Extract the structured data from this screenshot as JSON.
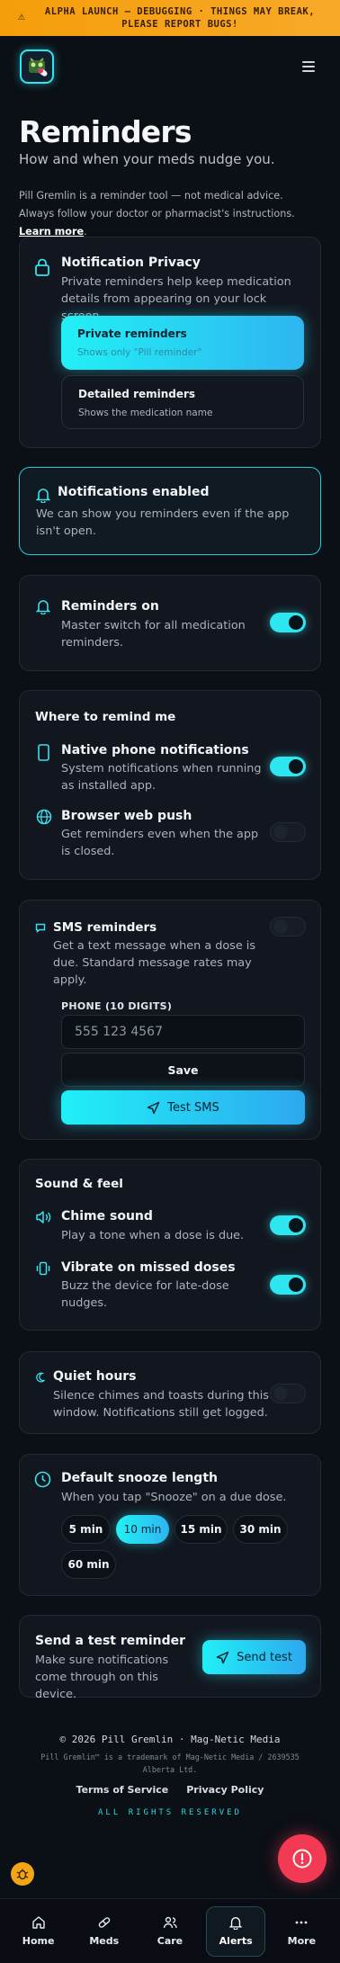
{
  "banner": {
    "text": "ALPHA LAUNCH — DEBUGGING · THINGS MAY BREAK, PLEASE REPORT BUGS!",
    "icon": "warning-icon"
  },
  "header": {
    "logo_icon": "pill-gremlin-logo",
    "menu_icon": "hamburger-menu-icon"
  },
  "page": {
    "title": "Reminders",
    "subtitle": "How and when your meds nudge you.",
    "disclaimer": "Pill Gremlin is a reminder tool — not medical advice. Always follow your doctor or pharmacist's instructions.",
    "learn_more": "Learn more"
  },
  "privacy": {
    "title": "Notification Privacy",
    "desc": "Private reminders help keep medication details from appearing on your lock screen.",
    "options": [
      {
        "title": "Private reminders",
        "desc": "Shows only \"Pill reminder\"",
        "selected": true
      },
      {
        "title": "Detailed reminders",
        "desc": "Shows the medication name",
        "selected": false
      }
    ]
  },
  "enabled_notice": {
    "title": "Notifications enabled",
    "desc": "We can show you reminders even if the app isn't open."
  },
  "master": {
    "title": "Reminders on",
    "desc": "Master switch for all medication reminders.",
    "on": true
  },
  "where": {
    "heading": "Where to remind me",
    "native": {
      "title": "Native phone notifications",
      "desc": "System notifications when running as installed app.",
      "on": true
    },
    "web": {
      "title": "Browser web push",
      "desc": "Get reminders even when the app is closed.",
      "on": false
    }
  },
  "sms": {
    "title": "SMS reminders",
    "desc": "Get a text message when a dose is due. Standard message rates may apply.",
    "on": false,
    "phone_label": "PHONE (10 DIGITS)",
    "phone_placeholder": "555 123 4567",
    "save_label": "Save",
    "test_label": "Test SMS"
  },
  "sound": {
    "heading": "Sound & feel",
    "chime": {
      "title": "Chime sound",
      "desc": "Play a tone when a dose is due.",
      "on": true
    },
    "vibrate": {
      "title": "Vibrate on missed doses",
      "desc": "Buzz the device for late-dose nudges.",
      "on": true
    }
  },
  "quiet": {
    "title": "Quiet hours",
    "desc": "Silence chimes and toasts during this window. Notifications still get logged.",
    "on": false
  },
  "snooze": {
    "title": "Default snooze length",
    "desc": "When you tap \"Snooze\" on a due dose.",
    "options": [
      "5 min",
      "10 min",
      "15 min",
      "30 min",
      "60 min"
    ],
    "selected": "10 min"
  },
  "test": {
    "title": "Send a test reminder",
    "desc": "Make sure notifications come through on this device.",
    "button": "Send test"
  },
  "footer": {
    "copyright": "© 2026 Pill Gremlin · Mag-Netic Media",
    "trademark": "Pill Gremlin™ is a trademark of Mag-Netic Media / 2639535 Alberta Ltd.",
    "links": [
      "Terms of Service",
      "Privacy Policy"
    ],
    "reserved": "ALL RIGHTS RESERVED"
  },
  "nav": {
    "items": [
      {
        "label": "Home",
        "icon": "home-icon"
      },
      {
        "label": "Meds",
        "icon": "pill-icon"
      },
      {
        "label": "Care",
        "icon": "people-icon"
      },
      {
        "label": "Alerts",
        "icon": "bell-icon",
        "active": true
      },
      {
        "label": "More",
        "icon": "more-dots-icon"
      }
    ]
  },
  "colors": {
    "accent": "#2ee6f0",
    "alert": "#f23a55",
    "banner": "#f59e0b"
  }
}
